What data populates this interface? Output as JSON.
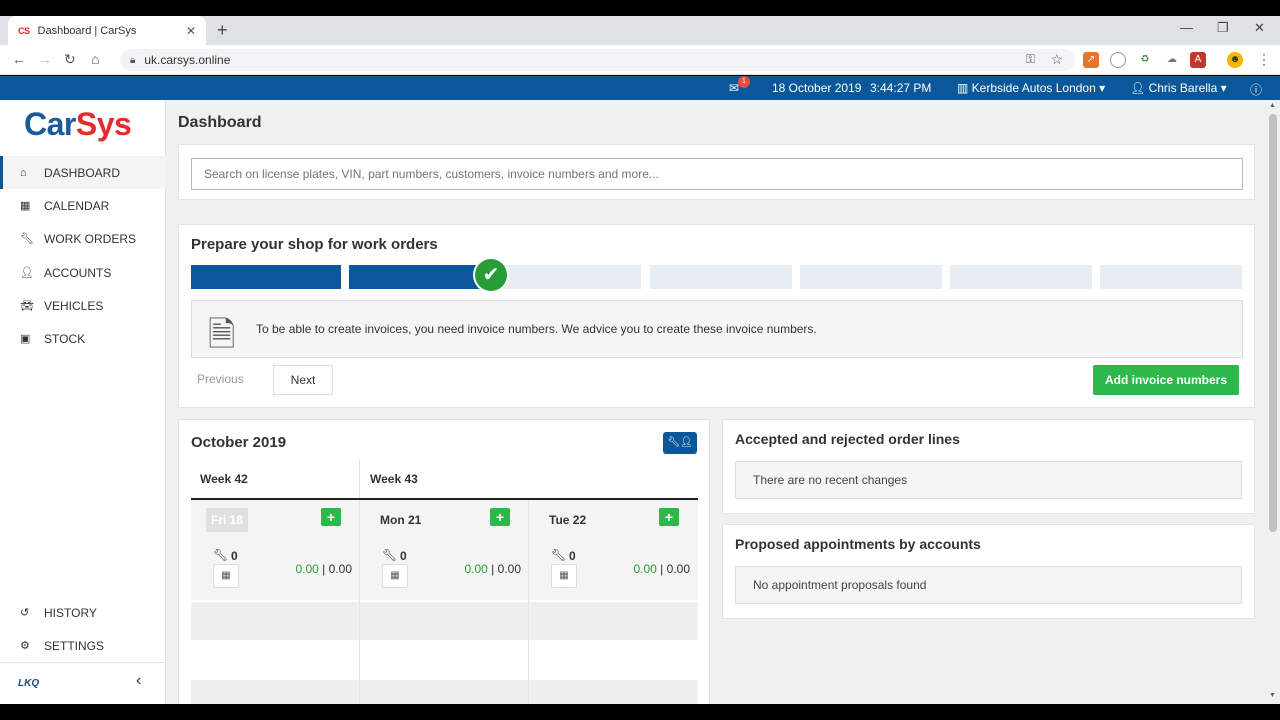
{
  "browser": {
    "tab_title": "Dashboard | CarSys",
    "tab_favicon": "CS",
    "url": "uk.carsys.online"
  },
  "topbar": {
    "notification_count": "1",
    "date": "18 October 2019",
    "time": "3:44:27 PM",
    "garage": "Kerbside Autos London",
    "user": "Chris Barella"
  },
  "sidebar": {
    "logo_car": "Car",
    "logo_sys": "Sys",
    "items": [
      {
        "label": "DASHBOARD"
      },
      {
        "label": "CALENDAR"
      },
      {
        "label": "WORK ORDERS"
      },
      {
        "label": "ACCOUNTS"
      },
      {
        "label": "VEHICLES"
      },
      {
        "label": "STOCK"
      }
    ],
    "bottom_items": [
      {
        "label": "HISTORY"
      },
      {
        "label": "SETTINGS"
      }
    ],
    "footer_logo": "LKQ"
  },
  "main": {
    "title": "Dashboard",
    "search_placeholder": "Search on license plates, VIN, part numbers, customers, invoice numbers and more...",
    "prepare": {
      "title": "Prepare your shop for work orders",
      "info": "To be able to create invoices, you need invoice numbers. We advice you to create these invoice numbers.",
      "previous": "Previous",
      "next": "Next",
      "add_button": "Add invoice numbers"
    },
    "calendar": {
      "title": "October 2019",
      "weeks": [
        "Week 42",
        "Week 43"
      ],
      "days": [
        {
          "label": "Fri 18",
          "orders": "0",
          "amount_done": "0.00",
          "amount_total": "0.00"
        },
        {
          "label": "Mon 21",
          "orders": "0",
          "amount_done": "0.00",
          "amount_total": "0.00"
        },
        {
          "label": "Tue 22",
          "orders": "0",
          "amount_done": "0.00",
          "amount_total": "0.00"
        }
      ]
    },
    "order_lines": {
      "title": "Accepted and rejected order lines",
      "empty": "There are no recent changes"
    },
    "appointments": {
      "title": "Proposed appointments by accounts",
      "empty": "No appointment proposals found"
    }
  },
  "colors": {
    "brand_blue": "#0a5899",
    "brand_red": "#e52b2b",
    "success_green": "#2eb84b"
  }
}
